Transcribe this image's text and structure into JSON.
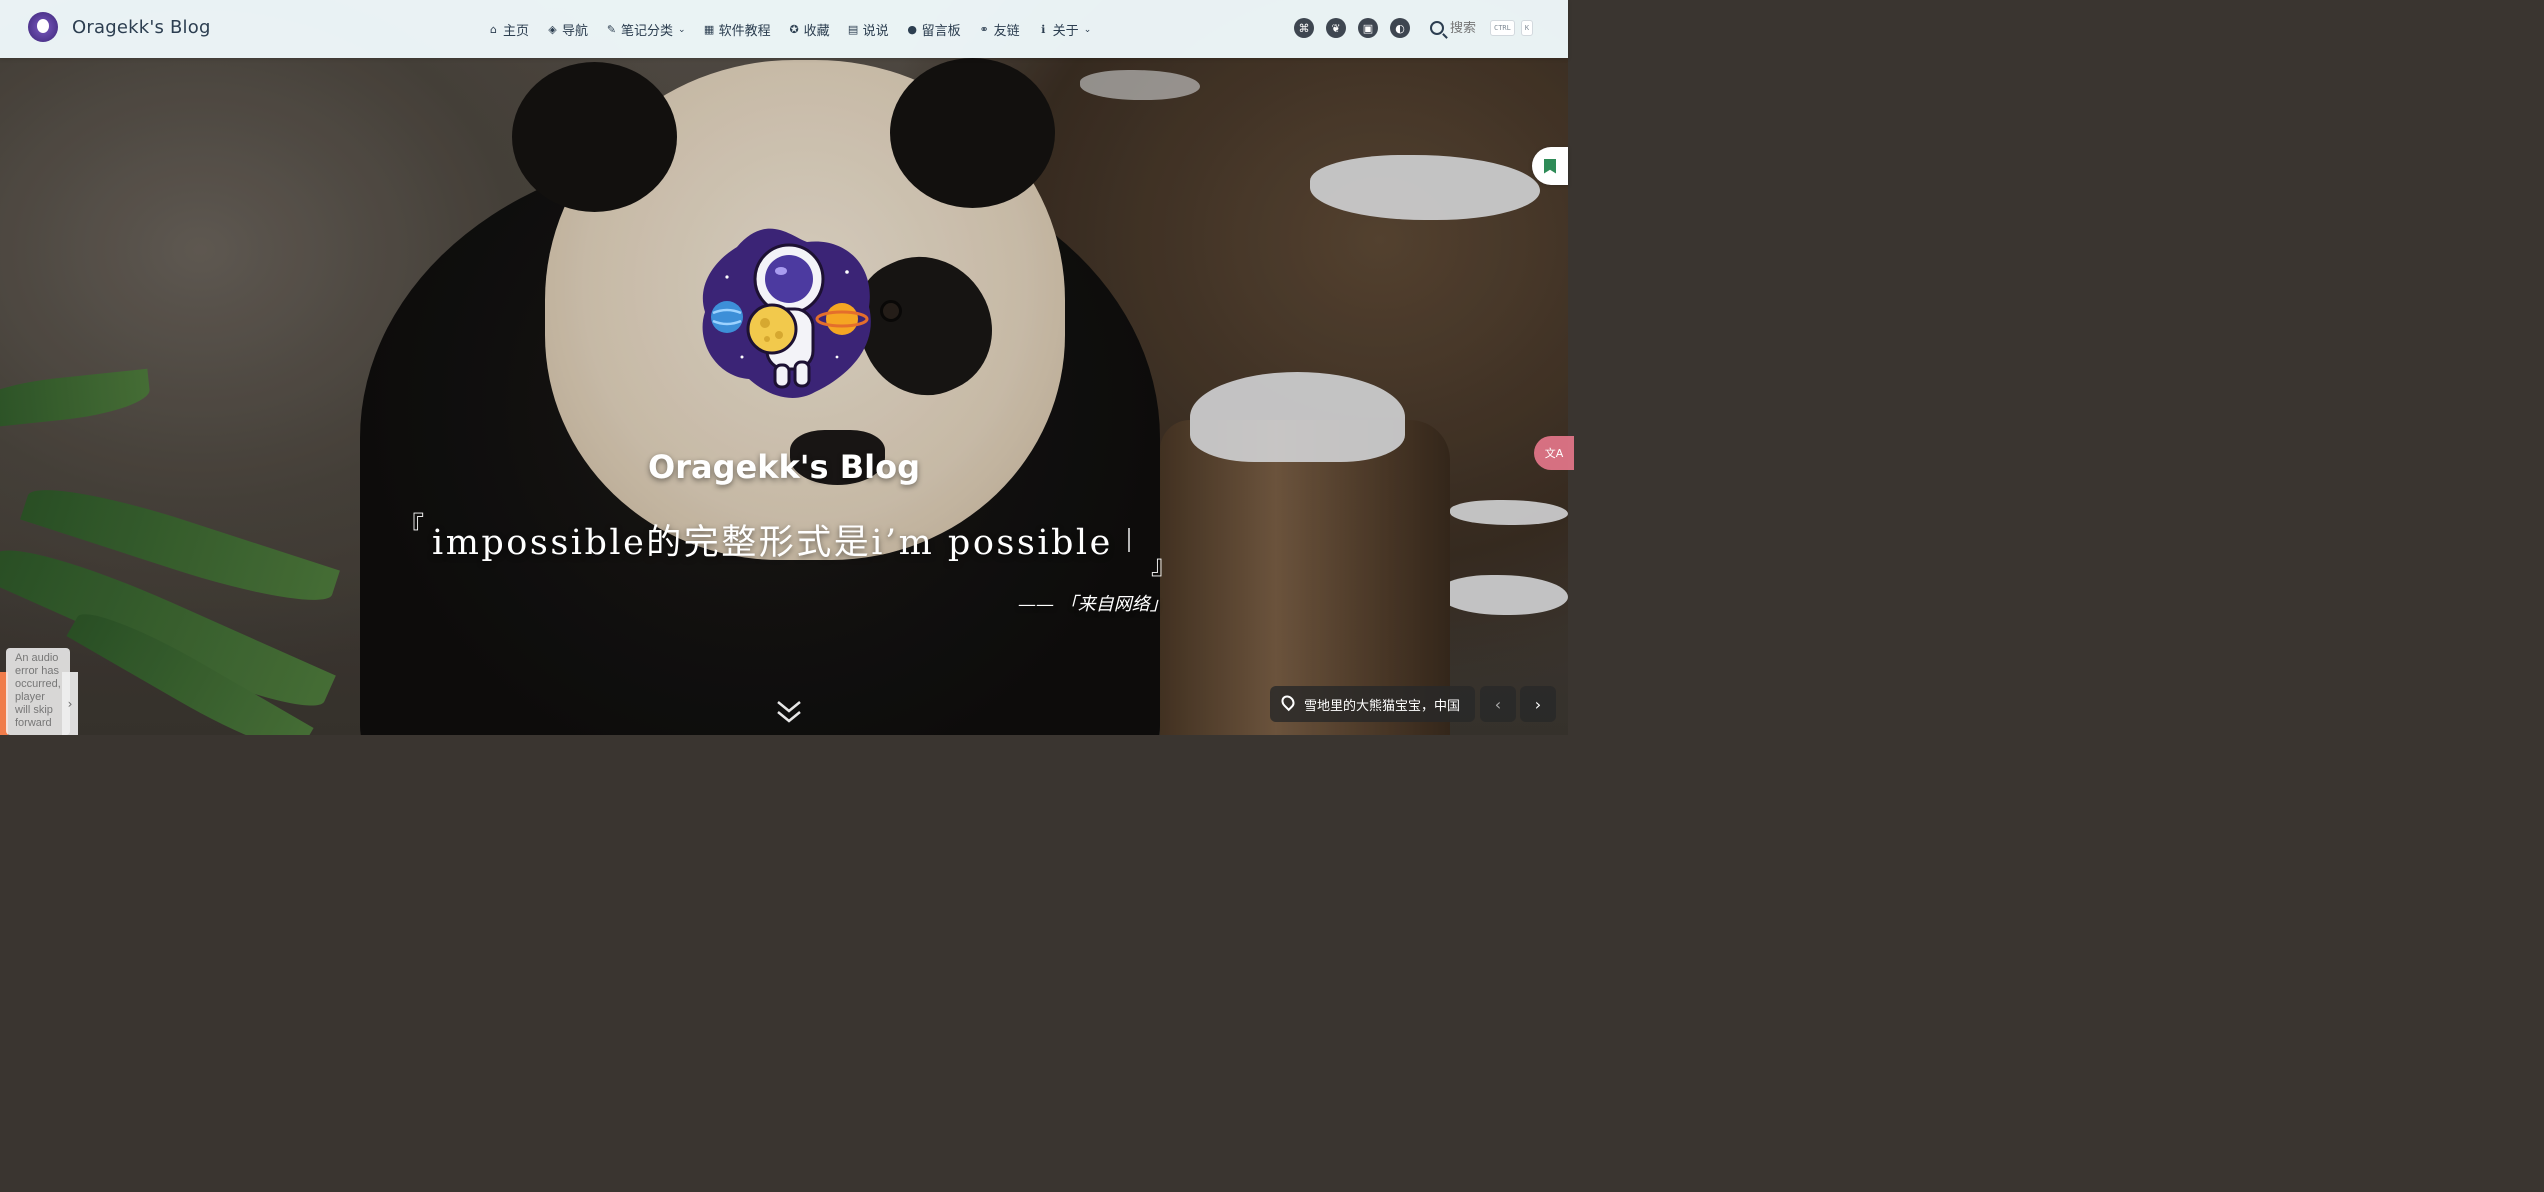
{
  "window": {
    "title": "Oragekk's Blog"
  },
  "navbar": {
    "brand": "Oragekk's Blog",
    "menu": [
      {
        "icon": "home-icon",
        "glyph": "⌂",
        "label": "主页",
        "dropdown": false
      },
      {
        "icon": "compass-icon",
        "glyph": "◈",
        "label": "导航",
        "dropdown": false
      },
      {
        "icon": "edit-icon",
        "glyph": "✎",
        "label": "笔记分类",
        "dropdown": true
      },
      {
        "icon": "app-icon",
        "glyph": "▦",
        "label": "软件教程",
        "dropdown": false
      },
      {
        "icon": "star-icon",
        "glyph": "✪",
        "label": "收藏",
        "dropdown": false
      },
      {
        "icon": "card-icon",
        "glyph": "▤",
        "label": "说说",
        "dropdown": false
      },
      {
        "icon": "comment-icon",
        "glyph": "●",
        "label": "留言板",
        "dropdown": false
      },
      {
        "icon": "link-icon",
        "glyph": "⚭",
        "label": "友链",
        "dropdown": false
      },
      {
        "icon": "info-icon",
        "glyph": "ℹ",
        "label": "关于",
        "dropdown": true
      }
    ],
    "tools": [
      {
        "icon": "github-icon",
        "glyph": "⌘"
      },
      {
        "icon": "leaf-icon",
        "glyph": "❦"
      },
      {
        "icon": "train-icon",
        "glyph": "▣"
      },
      {
        "icon": "theme-icon",
        "glyph": "◐"
      }
    ],
    "search": {
      "placeholder": "搜索",
      "shortcut_1": "CTRL",
      "shortcut_2": "K"
    }
  },
  "hero": {
    "title": "Oragekk's Blog",
    "quote_open": "『",
    "quote": "impossible的完整形式是i’m possible",
    "quote_close": "』",
    "source": "—— 「来自网络」"
  },
  "widgets": {
    "audio_error": "An audio error has occurred, player will skip forward",
    "player_toggle": "›",
    "translate": "文A",
    "location": "雪地里的大熊猫宝宝，中国",
    "prev_arrow": "‹",
    "next_arrow": "›"
  },
  "colors": {
    "navbar_bg": "#f0fafc",
    "accent_green": "#2e8b57",
    "translate_pink": "#e8788c"
  }
}
